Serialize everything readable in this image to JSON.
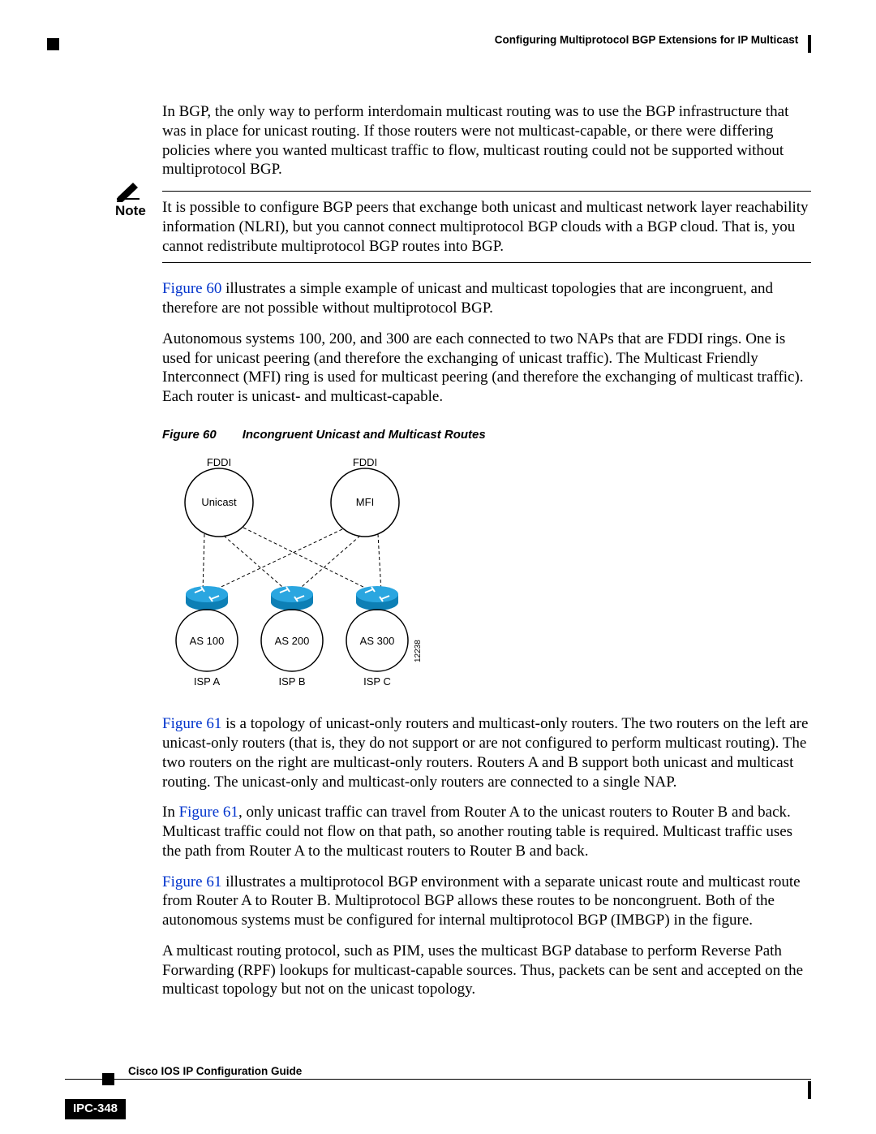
{
  "header": {
    "title": "Configuring Multiprotocol BGP Extensions for IP Multicast"
  },
  "para1": "In BGP, the only way to perform interdomain multicast routing was to use the BGP infrastructure that was in place for unicast routing. If those routers were not multicast-capable, or there were differing policies where you wanted multicast traffic to flow, multicast routing could not be supported without multiprotocol BGP.",
  "note": {
    "label": "Note",
    "text": "It is possible to configure BGP peers that exchange both unicast and multicast network layer reachability information (NLRI), but you cannot connect multiprotocol BGP clouds with a BGP cloud. That is, you cannot redistribute multiprotocol BGP routes into BGP."
  },
  "para2a": "Figure 60",
  "para2b": " illustrates a simple example of unicast and multicast topologies that are incongruent, and therefore are not possible without multiprotocol BGP.",
  "para3": "Autonomous systems 100, 200, and 300 are each connected to two NAPs that are FDDI rings. One is used for unicast peering (and therefore the exchanging of unicast traffic). The Multicast Friendly Interconnect (MFI) ring is used for multicast peering (and therefore the exchanging of multicast traffic). Each router is unicast- and multicast-capable.",
  "figure": {
    "num": "Figure 60",
    "title": "Incongruent Unicast and Multicast Routes",
    "labels": {
      "fddi1": "FDDI",
      "fddi2": "FDDI",
      "unicast": "Unicast",
      "mfi": "MFI",
      "as100": "AS 100",
      "as200": "AS 200",
      "as300": "AS 300",
      "ispa": "ISP A",
      "ispb": "ISP B",
      "ispc": "ISP C",
      "id": "12238"
    }
  },
  "para4a": "Figure 61",
  "para4b": " is a topology of unicast-only routers and multicast-only routers. The two routers on the left are unicast-only routers (that is, they do not support or are not configured to perform multicast routing). The two routers on the right are multicast-only routers. Routers A and B support both unicast and multicast routing. The unicast-only and multicast-only routers are connected to a single NAP.",
  "para5a": "In ",
  "para5b": "Figure 61",
  "para5c": ", only unicast traffic can travel from Router A to the unicast routers to Router B and back. Multicast traffic could not flow on that path, so another routing table is required. Multicast traffic uses the path from Router A to the multicast routers to Router B and back.",
  "para6a": "Figure 61",
  "para6b": " illustrates a multiprotocol BGP environment with a separate unicast route and multicast route from Router A to Router B. Multiprotocol BGP allows these routes to be noncongruent. Both of the autonomous systems must be configured for internal multiprotocol BGP (IMBGP) in the figure.",
  "para7": "A multicast routing protocol, such as PIM, uses the multicast BGP database to perform Reverse Path Forwarding (RPF) lookups for multicast-capable sources. Thus, packets can be sent and accepted on the multicast topology but not on the unicast topology.",
  "footer": {
    "guide": "Cisco IOS IP Configuration Guide",
    "page": "IPC-348"
  }
}
